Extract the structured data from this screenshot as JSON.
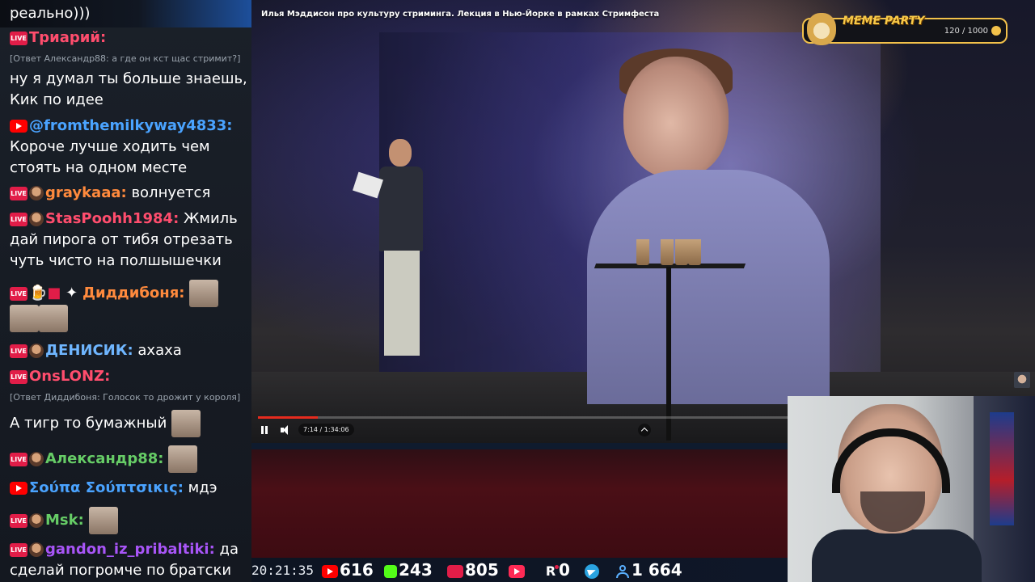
{
  "video": {
    "title": "Илья Мэддисон про культуру стриминга. Лекция в Нью-Йорке в рамках Стримфеста",
    "current_time": "7:14",
    "separator": "/",
    "duration": "1:34:06",
    "progress_fraction": 0.077
  },
  "meme_party": {
    "title": "MEME PARTY",
    "count": "120 / 1000"
  },
  "chat": {
    "messages": [
      {
        "text": "реально)))"
      },
      {
        "name": "Триарий:",
        "name_color": "#ff4d6d"
      },
      {
        "reply": "[Ответ Александр88: а где он кст щас стримит?]"
      },
      {
        "text": "ну я думал ты больше знаешь, Кик по идее"
      },
      {
        "name": "@fromthemilkyway4833:",
        "name_color": "#4aa3ff"
      },
      {
        "text": "Короче лучше ходить чем стоять на одном месте"
      },
      {
        "name": "graykaaa:",
        "name_color": "#ff8a3d",
        "text": "волнуется"
      },
      {
        "name": "StasPoohh1984:",
        "name_color": "#ff4d6d",
        "text": "Жмиль дай пирога от тибя отрезать чуть чисто на полшышечки"
      },
      {
        "name": "Диддибоня:",
        "name_color": "#ff8a3d"
      },
      {
        "name": "ДЕНИСИК:",
        "name_color": "#6fb6ff",
        "text": "ахаха"
      },
      {
        "name": "OnsLONZ:",
        "name_color": "#ff4d6d"
      },
      {
        "reply": "[Ответ Диддибоня: Голосок то дрожит у короля]"
      },
      {
        "text": "А тигр то бумажный"
      },
      {
        "name": "Александр88:",
        "name_color": "#66cc66"
      },
      {
        "name": "Σούπα Σούπτσικις:",
        "name_color": "#4aa3ff",
        "text": "мдэ"
      },
      {
        "name": "Msk:",
        "name_color": "#66cc66"
      },
      {
        "name": "gandon_iz_pribaltiki:",
        "name_color": "#a855f7",
        "text": "да сделай погромче по братски"
      }
    ]
  },
  "stats": {
    "clock": "20:21:35",
    "youtube": "616",
    "kick": "243",
    "live": "805",
    "rutube": "0",
    "total_viewers": "1 664"
  }
}
